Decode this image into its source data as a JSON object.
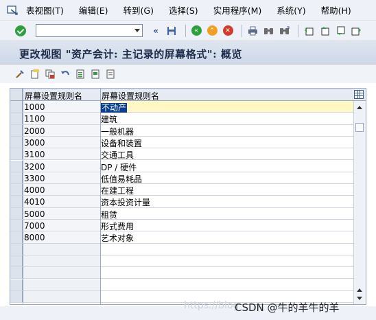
{
  "menubar": {
    "items": [
      "表视图(T)",
      "编辑(E)",
      "转到(G)",
      "选择(S)",
      "实用程序(M)",
      "系统(Y)",
      "帮助(H)"
    ]
  },
  "toolbar": {
    "command_value": "",
    "icons": [
      "enter-icon",
      "save-icon",
      "back-icon",
      "exit-icon",
      "cancel-icon",
      "print-icon",
      "find-icon",
      "find-next-icon",
      "first-page-icon",
      "prev-page-icon",
      "next-page-icon",
      "last-page-icon"
    ]
  },
  "title": "更改视图 \"资产会计: 主记录的屏幕格式\": 概览",
  "table": {
    "headers": [
      "屏幕设置规则名",
      "屏幕设置规则名"
    ],
    "rows": [
      {
        "code": "1000",
        "name": "不动产"
      },
      {
        "code": "1100",
        "name": "建筑"
      },
      {
        "code": "2000",
        "name": "一般机器"
      },
      {
        "code": "3000",
        "name": "设备和装置"
      },
      {
        "code": "3100",
        "name": "交通工具"
      },
      {
        "code": "3200",
        "name": "DP / 硬件"
      },
      {
        "code": "3300",
        "name": "低值易耗品"
      },
      {
        "code": "4000",
        "name": "在建工程"
      },
      {
        "code": "4010",
        "name": "资本投资计量"
      },
      {
        "code": "5000",
        "name": "租赁"
      },
      {
        "code": "7000",
        "name": "形式费用"
      },
      {
        "code": "8000",
        "name": "艺术对象"
      }
    ]
  },
  "watermark": {
    "faint": "https://blog",
    "main": "CSDN @牛的羊牛的羊"
  }
}
